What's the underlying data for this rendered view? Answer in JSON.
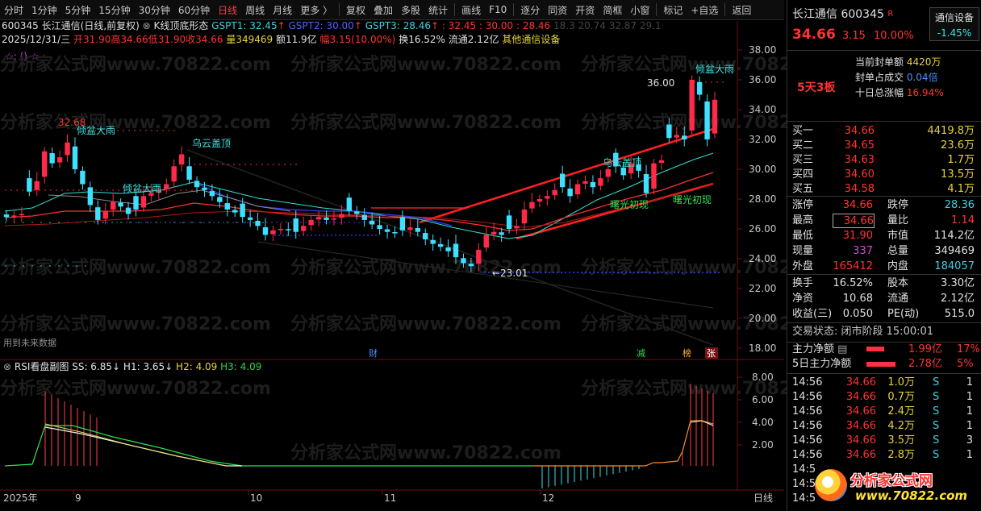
{
  "toolbar": {
    "items": [
      "分时",
      "1分钟",
      "5分钟",
      "15分钟",
      "30分钟",
      "60分钟",
      "日线",
      "周线",
      "月线",
      "更多 〉",
      "复权",
      "叠加",
      "多股",
      "统计",
      "画线",
      "F10",
      "逐分",
      "同资",
      "开资",
      "简框",
      "小窗",
      "标记",
      "+自选",
      "返回"
    ],
    "active": "日线"
  },
  "info": {
    "line1_code": "600345",
    "line1_name": "长江通信(日线,前复权)",
    "line1_indicator": "K线顶底形态",
    "gspt1": "GSPT1: 32.45",
    "gspt2": "GSPT2: 30.00",
    "gspt3": "GSPT3: 28.46",
    "gspt_extra": ": 32.45 : 30.00 : 28.46",
    "gspt_extra2": "18.3  20.74  32.87  29.1",
    "line2_date": "2025/12/31/三",
    "line2_open": "开31.90",
    "line2_high": "高34.66",
    "line2_low": "低31.90",
    "line2_close": "收34.66",
    "line2_vol": "量349469",
    "line2_amt": "额11.9亿",
    "line2_pct": "幅3.15(10.00%)",
    "line2_turn": "换16.52%",
    "line2_float": "流通2.12亿",
    "line2_sector": "其他通信设备",
    "line3": "☆: () ☆"
  },
  "main_chart": {
    "y_ticks": [
      "38.00",
      "36.00",
      "34.00",
      "32.00",
      "30.00",
      "28.00",
      "26.00",
      "24.00",
      "22.00",
      "20.00",
      "18.00"
    ],
    "annotations": {
      "high_left": "32.68",
      "high_right": "36.00",
      "low": "←23.01",
      "pattern1": "倾盆大雨",
      "pattern2": "倾盆大雨",
      "pattern3": "乌云盖顶",
      "pattern4": "乌云盖顶",
      "pattern5": "曙光初现",
      "pattern6": "曙光初现",
      "pattern7": "倾盆大雨",
      "future_note": "用到未来数据",
      "marker_cai": "财",
      "marker_jian": "减",
      "marker_bang": "榜",
      "marker_zhang": "张"
    }
  },
  "sub_chart": {
    "title": "RSI看盘副图",
    "ss": "SS: 6.85↓",
    "h1": "H1: 3.65↓",
    "h2": "H2: 4.09",
    "h3": "H3: 4.09",
    "y_ticks": [
      "8.00",
      "6.00",
      "4.00",
      "2.00"
    ]
  },
  "x_axis": {
    "labels": [
      "2025年",
      "9",
      "10",
      "11",
      "12"
    ],
    "period": "日线"
  },
  "watermark": "分析家公式网www.70822.com",
  "right_panel": {
    "name": "长江通信",
    "code": "600345",
    "r_badge": "R",
    "sector_btn": "通信设备",
    "sector_pct": "-1.45%",
    "price": "34.66",
    "change": "3.15",
    "pct": "10.00%",
    "limit_label": "5天3板",
    "seal_label": "当前封单额",
    "seal_val": "4420万",
    "seal_ratio_label": "封单占成交",
    "seal_ratio_val": "0.04倍",
    "ten_day_label": "十日总涨幅",
    "ten_day_val": "16.94%",
    "bids": [
      {
        "label": "买一",
        "price": "34.66",
        "vol": "4419.8万"
      },
      {
        "label": "买二",
        "price": "34.65",
        "vol": "23.6万"
      },
      {
        "label": "买三",
        "price": "34.63",
        "vol": "1.7万"
      },
      {
        "label": "买四",
        "price": "34.60",
        "vol": "13.5万"
      },
      {
        "label": "买五",
        "price": "34.58",
        "vol": "4.1万"
      }
    ],
    "stats": [
      {
        "l1": "涨停",
        "v1": "34.66",
        "l2": "跌停",
        "v2": "28.36"
      },
      {
        "l1": "最高",
        "v1": "34.66",
        "l2": "量比",
        "v2": "1.14"
      },
      {
        "l1": "最低",
        "v1": "31.90",
        "l2": "市值",
        "v2": "114.2亿"
      },
      {
        "l1": "现量",
        "v1": "337",
        "l2": "总量",
        "v2": "349469"
      },
      {
        "l1": "外盘",
        "v1": "165412",
        "l2": "内盘",
        "v2": "184057"
      }
    ],
    "stats2": [
      {
        "l1": "换手",
        "v1": "16.52%",
        "l2": "股本",
        "v2": "3.30亿"
      },
      {
        "l1": "净资",
        "v1": "10.68",
        "l2": "流通",
        "v2": "2.12亿"
      },
      {
        "l1": "收益(三)",
        "v1": "0.050",
        "l2": "PE(动)",
        "v2": "515.0"
      }
    ],
    "trade_status": "交易状态: 闭市阶段 15:00:01",
    "main_net_label": "主力净额",
    "main_net_val": "1.99亿",
    "main_net_pct": "17%",
    "five_day_label": "5日主力净额",
    "five_day_val": "2.78亿",
    "five_day_pct": "5%",
    "ticks": [
      {
        "t": "14:56",
        "p": "34.66",
        "v": "1.0万",
        "s": "S",
        "n": "1"
      },
      {
        "t": "14:56",
        "p": "34.66",
        "v": "0.7万",
        "s": "S",
        "n": "1"
      },
      {
        "t": "14:56",
        "p": "34.66",
        "v": "2.4万",
        "s": "S",
        "n": "1"
      },
      {
        "t": "14:56",
        "p": "34.66",
        "v": "4.2万",
        "s": "S",
        "n": "1"
      },
      {
        "t": "14:56",
        "p": "34.66",
        "v": "3.5万",
        "s": "S",
        "n": "3"
      },
      {
        "t": "14:56",
        "p": "34.66",
        "v": "2.8万",
        "s": "S",
        "n": "1"
      },
      {
        "t": "14:5",
        "p": "",
        "v": "",
        "s": "",
        "n": ""
      },
      {
        "t": "14:5",
        "p": "",
        "v": "",
        "s": "",
        "n": ""
      },
      {
        "t": "14:5",
        "p": "",
        "v": "",
        "s": "",
        "n": ""
      }
    ],
    "logo_text": "分析家公式网",
    "logo_url": "www.70822.com"
  }
}
